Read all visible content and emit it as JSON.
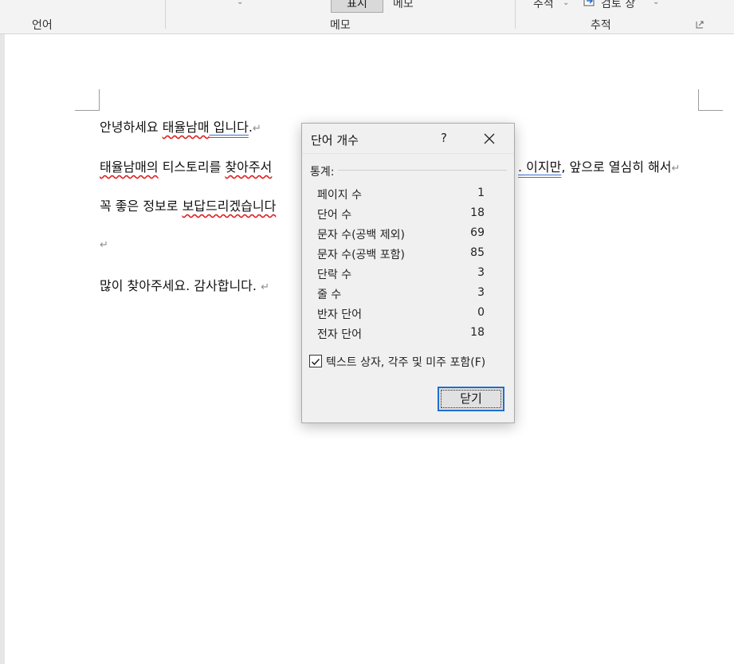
{
  "ribbon": {
    "groups": [
      "언어",
      "메모",
      "추적"
    ],
    "show_btn": "표시",
    "memo_btn": "메모",
    "track_btn": "추적",
    "review_btn": "검토 창"
  },
  "document": {
    "line1": {
      "a": "안녕하세요 ",
      "b": "태율남매",
      "c": " 입니다",
      "d": "."
    },
    "line2": {
      "a": "태율남매의",
      "b": " 티스토리를 ",
      "c": "찾아주서",
      "hidden_tail": ". 이지만",
      "d": ", 앞으로 열심히 해서"
    },
    "line3": {
      "a": "꼭 좋은 정보로 ",
      "b": "보답드리겠습니다"
    },
    "line5": "많이 찾아주세요. 감사합니다. ",
    "para_mark": "↵"
  },
  "dialog": {
    "title": "단어 개수",
    "help": "?",
    "group_label": "통계:",
    "stats": [
      {
        "label": "페이지 수",
        "value": "1"
      },
      {
        "label": "단어 수",
        "value": "18"
      },
      {
        "label": "문자 수(공백 제외)",
        "value": "69"
      },
      {
        "label": "문자 수(공백 포함)",
        "value": "85"
      },
      {
        "label": "단락 수",
        "value": "3"
      },
      {
        "label": "줄 수",
        "value": "3"
      },
      {
        "label": "반자 단어",
        "value": "0"
      },
      {
        "label": "전자 단어",
        "value": "18"
      }
    ],
    "checkbox_label": "텍스트 상자, 각주 및 미주 포함(F)",
    "checkbox_checked": true,
    "close_button": "닫기"
  }
}
